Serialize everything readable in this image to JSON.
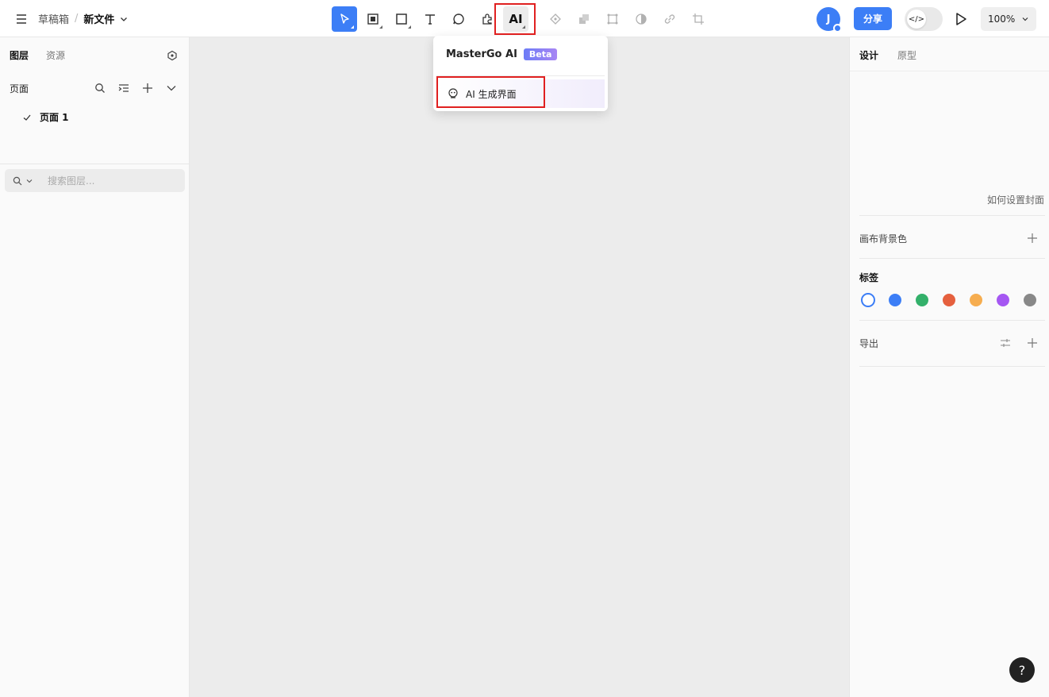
{
  "header": {
    "breadcrumb_parent": "草稿箱",
    "breadcrumb_separator": "/",
    "file_name": "新文件",
    "ai_tool_label": "AI",
    "avatar_initial": "J",
    "share_label": "分享",
    "dev_mode_label": "</>",
    "zoom_level": "100%"
  },
  "toolbar": {
    "tools": [
      "move-tool",
      "frame-tool",
      "rectangle-tool",
      "text-tool",
      "comment-tool",
      "plugin-tool",
      "ai-tool",
      "component-tool",
      "boolean-tool",
      "mask-tool",
      "contrast-tool",
      "link-tool",
      "crop-tool"
    ]
  },
  "left_panel": {
    "tabs": [
      "图层",
      "资源"
    ],
    "active_tab": "图层",
    "pages_title": "页面",
    "pages": [
      "页面 1"
    ],
    "layer_search_placeholder": "搜索图层..."
  },
  "right_panel": {
    "tabs": [
      "设计",
      "原型"
    ],
    "active_tab": "设计",
    "cover_link": "如何设置封面",
    "canvas_bg_label": "画布背景色",
    "tags_label": "标签",
    "tag_colors": [
      "#3c7ef6",
      "#3c7ef6",
      "#33b06a",
      "#e5603e",
      "#f6ad4f",
      "#a557f2",
      "#888888"
    ],
    "export_label": "导出"
  },
  "ai_dropdown": {
    "title": "MasterGo AI",
    "badge": "Beta",
    "item_label": "AI 生成界面"
  },
  "help_label": "?",
  "colors": {
    "accent": "#3c7ef6",
    "highlight": "#e02020"
  }
}
